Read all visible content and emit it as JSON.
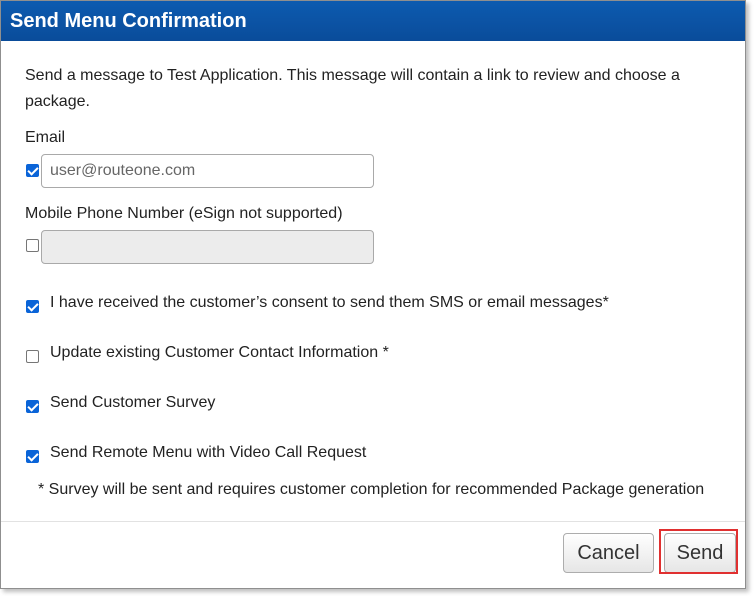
{
  "dialog": {
    "title": "Send Menu Confirmation",
    "intro": "Send a message to Test Application. This message will contain a link to review and choose a package."
  },
  "email": {
    "label": "Email",
    "checked": true,
    "value": "user@routeone.com"
  },
  "phone": {
    "label": "Mobile Phone Number (eSign not supported)",
    "checked": false,
    "value": ""
  },
  "options": [
    {
      "label": "I have received the customer’s consent to send them SMS or email messages*",
      "checked": true
    },
    {
      "label": "Update existing Customer Contact Information *",
      "checked": false
    },
    {
      "label": "Send Customer Survey",
      "checked": true
    },
    {
      "label": "Send Remote Menu with Video Call Request",
      "checked": true
    }
  ],
  "footnote": "* Survey will be sent and requires customer completion for recommended Package generation",
  "buttons": {
    "cancel": "Cancel",
    "send": "Send"
  },
  "colors": {
    "titlebar": "#0a4c9a",
    "checkbox": "#0a64d8",
    "highlight": "#e03030"
  }
}
